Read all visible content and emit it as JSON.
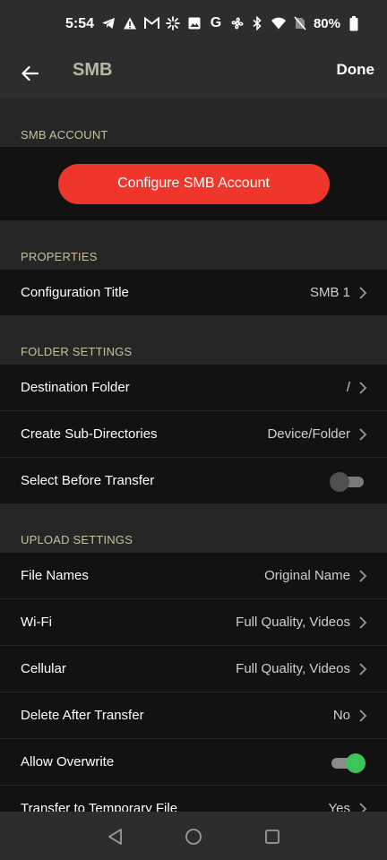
{
  "status_bar": {
    "time": "5:54",
    "battery": "80%",
    "left_icons": [
      "telegram-icon",
      "warning-icon",
      "gmail-icon",
      "sparkle-icon",
      "image-icon",
      "google-icon",
      "fan-icon"
    ],
    "right_icons": [
      "bluetooth-icon",
      "wifi-icon",
      "no-sim-icon",
      "battery-icon"
    ]
  },
  "app_bar": {
    "title": "SMB",
    "done_label": "Done"
  },
  "sections": {
    "account": {
      "header": "SMB ACCOUNT",
      "button_label": "Configure SMB Account"
    },
    "properties": {
      "header": "PROPERTIES",
      "configuration_title": {
        "label": "Configuration Title",
        "value": "SMB 1"
      }
    },
    "folder": {
      "header": "FOLDER SETTINGS",
      "destination": {
        "label": "Destination Folder",
        "value": "/"
      },
      "subdirs": {
        "label": "Create Sub-Directories",
        "value": "Device/Folder"
      },
      "select_before": {
        "label": "Select Before Transfer",
        "enabled": false
      }
    },
    "upload": {
      "header": "UPLOAD SETTINGS",
      "file_names": {
        "label": "File Names",
        "value": "Original Name"
      },
      "wifi": {
        "label": "Wi-Fi",
        "value": "Full Quality, Videos"
      },
      "cellular": {
        "label": "Cellular",
        "value": "Full Quality, Videos"
      },
      "delete_after": {
        "label": "Delete After Transfer",
        "value": "No"
      },
      "allow_overwrite": {
        "label": "Allow Overwrite",
        "enabled": true
      },
      "temp_file": {
        "label": "Transfer to Temporary File",
        "value": "Yes"
      }
    }
  },
  "colors": {
    "accent_button": "#f0352b",
    "section_header": "#c6c0a1",
    "title": "#b7b8a6",
    "toggle_on": "#3bc45a"
  }
}
